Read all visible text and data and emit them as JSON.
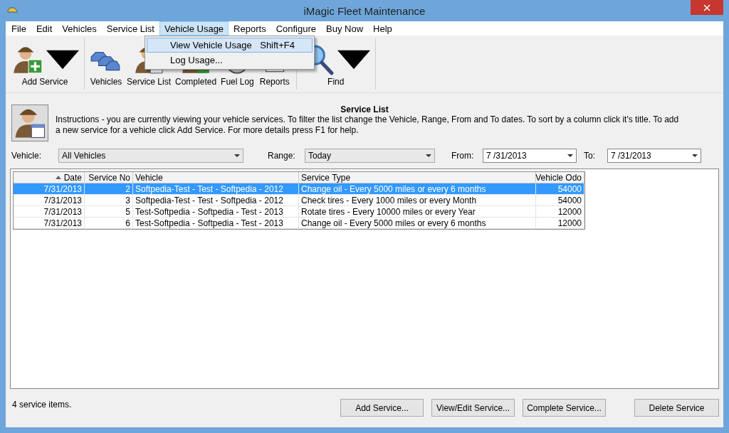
{
  "window": {
    "title": "iMagic Fleet Maintenance"
  },
  "menu": [
    {
      "label": "File",
      "selected": false
    },
    {
      "label": "Edit",
      "selected": false
    },
    {
      "label": "Vehicles",
      "selected": false
    },
    {
      "label": "Service List",
      "selected": false
    },
    {
      "label": "Vehicle Usage",
      "selected": true
    },
    {
      "label": "Reports",
      "selected": false
    },
    {
      "label": "Configure",
      "selected": false
    },
    {
      "label": "Buy Now",
      "selected": false
    },
    {
      "label": "Help",
      "selected": false
    }
  ],
  "open_menu": [
    {
      "label": "View Vehicle Usage",
      "shortcut": "Shift+F4",
      "selected": true
    },
    {
      "label": "Log Usage...",
      "selected": false
    }
  ],
  "toolbar": [
    {
      "buttons": [
        {
          "label": "Add Service",
          "kind": "person-add",
          "dropdown": true
        }
      ]
    },
    {
      "buttons": [
        {
          "label": "Vehicles",
          "kind": "cars",
          "dropdown": false
        },
        {
          "label": "Service List",
          "kind": "person-calendar",
          "dropdown": false
        },
        {
          "label": "Completed",
          "kind": "person-check",
          "dropdown": false
        },
        {
          "label": "Fuel Log",
          "kind": "gauge",
          "dropdown": false
        },
        {
          "label": "Reports",
          "kind": "report",
          "dropdown": false
        }
      ]
    },
    {
      "buttons": [
        {
          "label": "Find",
          "kind": "magnifier",
          "dropdown": true
        }
      ]
    }
  ],
  "section": {
    "title": "Service List",
    "instructions": "Instructions - you are currently viewing your vehicle services. To filter the list change the Vehicle, Range, From and To dates.  To sort by a column click it's title. To add a new service for a vehicle click Add Service. For more details press F1 for help."
  },
  "filters": {
    "vehicle_label": "Vehicle:",
    "vehicle": "All Vehicles",
    "range_label": "Range:",
    "range": "Today",
    "from_label": "From:",
    "from": "7 /31/2013",
    "to_label": "To:",
    "to": "7 /31/2013"
  },
  "table": {
    "columns": [
      {
        "label": "Date",
        "sorted": true
      },
      {
        "label": "Service No",
        "sorted": false
      },
      {
        "label": "Vehicle",
        "sorted": false
      },
      {
        "label": "Service Type",
        "sorted": false
      },
      {
        "label": "Vehicle Odo",
        "sorted": false
      }
    ],
    "rows": [
      {
        "cells": [
          "7/31/2013",
          "2",
          "Softpedia-Test - Test - Softpedia - 2012",
          "Change oil - Every 5000 miles or every 6 months",
          "54000"
        ],
        "selected": true
      },
      {
        "cells": [
          "7/31/2013",
          "3",
          "Softpedia-Test - Test - Softpedia - 2012",
          "Check tires - Every 1000 miles or every Month",
          "54000"
        ],
        "selected": false
      },
      {
        "cells": [
          "7/31/2013",
          "5",
          "Test-Softpedia - Softpedia - Test - 2013",
          "Rotate tires - Every 10000 miles or every Year",
          "12000"
        ],
        "selected": false
      },
      {
        "cells": [
          "7/31/2013",
          "6",
          "Test-Softpedia - Softpedia - Test - 2013",
          "Change oil - Every 5000 miles or every 6 months",
          "12000"
        ],
        "selected": false
      }
    ]
  },
  "status": "4 service items.",
  "buttons": [
    {
      "label": "Add Service..."
    },
    {
      "label": "View/Edit Service..."
    },
    {
      "label": "Complete Service..."
    },
    {
      "label": "Delete Service"
    }
  ]
}
